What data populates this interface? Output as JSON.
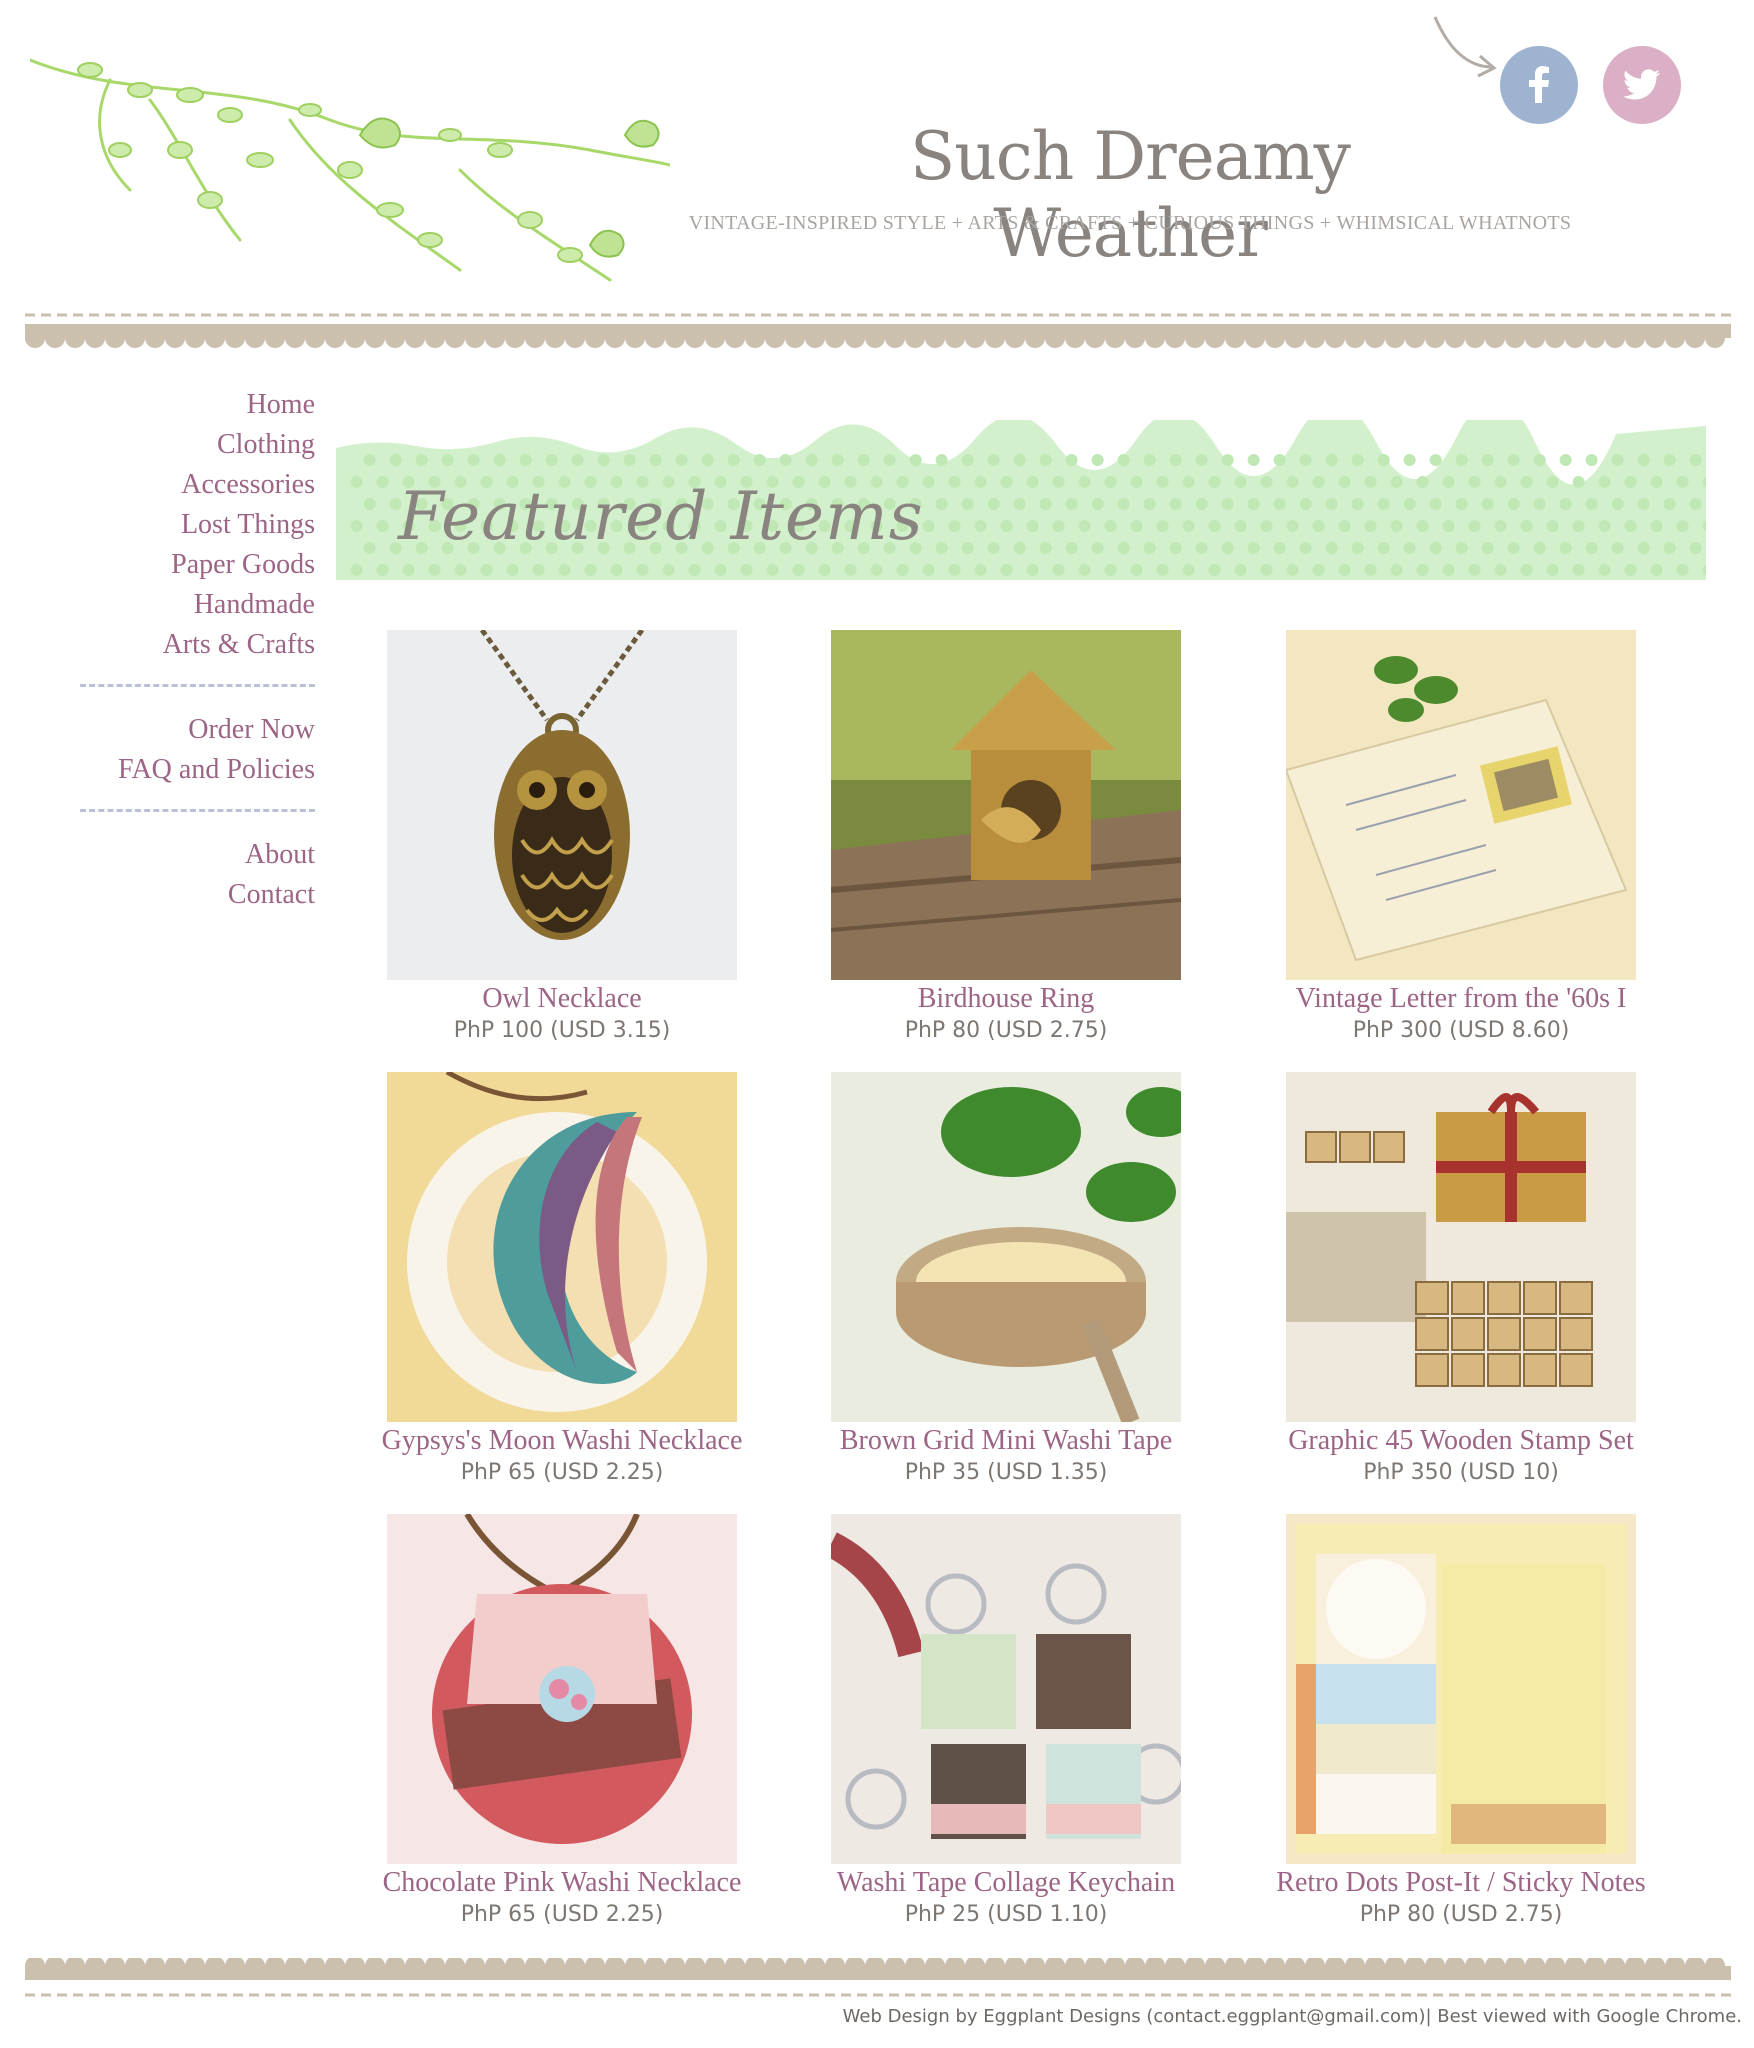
{
  "header": {
    "title": "Such Dreamy Weather",
    "tagline": "VINTAGE-INSPIRED STYLE + ARTS & CRAFTS + CURIOUS THINGS + WHIMSICAL WHATNOTS",
    "social": [
      {
        "icon": "facebook-icon",
        "color": "#9eb3cf"
      },
      {
        "icon": "twitter-icon",
        "color": "#dbb0c6"
      }
    ]
  },
  "sidebar": {
    "group1": [
      "Home",
      "Clothing",
      "Accessories",
      "Lost Things",
      "Paper Goods",
      "Handmade",
      "Arts & Crafts"
    ],
    "group2": [
      "Order Now",
      "FAQ and Policies"
    ],
    "group3": [
      "About",
      "Contact"
    ]
  },
  "featured": {
    "heading": "Featured Items"
  },
  "products": [
    {
      "name": "Owl Necklace",
      "price": "PhP 100 (USD 3.15)"
    },
    {
      "name": "Birdhouse Ring",
      "price": "PhP 80 (USD 2.75)"
    },
    {
      "name": "Vintage Letter from the '60s I",
      "price": "PhP 300 (USD 8.60)"
    },
    {
      "name": "Gypsys's Moon Washi Necklace",
      "price": "PhP 65 (USD 2.25)"
    },
    {
      "name": "Brown Grid Mini Washi Tape",
      "price": "PhP 35 (USD 1.35)"
    },
    {
      "name": "Graphic 45 Wooden Stamp Set",
      "price": "PhP 350 (USD 10)"
    },
    {
      "name": "Chocolate Pink Washi Necklace",
      "price": "PhP 65 (USD 2.25)"
    },
    {
      "name": "Washi Tape Collage Keychain",
      "price": "PhP 25 (USD 1.10)"
    },
    {
      "name": "Retro Dots Post-It / Sticky Notes",
      "price": "PhP 80 (USD 2.75)"
    }
  ],
  "footer": {
    "text": "Web Design by Eggplant Designs (contact.eggplant@gmail.com)| Best viewed with Google Chrome."
  },
  "colors": {
    "link": "#9c6586",
    "heading": "#8a8480",
    "border": "#cbbfae",
    "lace": "#c7ebbf"
  }
}
